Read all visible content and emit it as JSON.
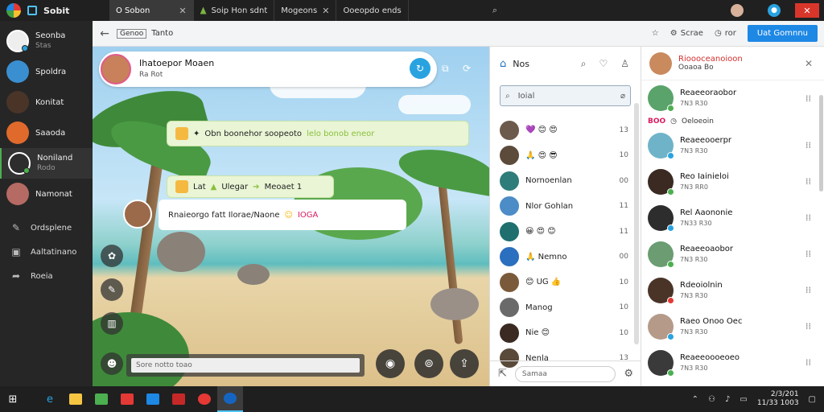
{
  "titlebar": {
    "app_name": "Sobit",
    "tabs": [
      {
        "label": "O Sobon",
        "active": true
      },
      {
        "label": "Soip Hon sdnt",
        "active": false
      },
      {
        "label": "Mogeons",
        "active": false
      },
      {
        "label": "Ooeopdo ends",
        "active": false
      }
    ]
  },
  "sidebar": {
    "contacts": [
      {
        "name": "Seonba",
        "sub": "Stas",
        "color": "#3b3b3b",
        "dot": true
      },
      {
        "name": "Spoldra",
        "sub": "",
        "color": "#3a8fd1",
        "dot": false
      },
      {
        "name": "Konitat",
        "sub": "",
        "color": "#4a3428",
        "dot": false
      },
      {
        "name": "Saaoda",
        "sub": "",
        "color": "#e06a2b",
        "dot": false
      },
      {
        "name": "Noniland",
        "sub": "Rodo",
        "color": "#2d2d2d",
        "dot": true,
        "active": true
      },
      {
        "name": "Namonat",
        "sub": "",
        "color": "#b56a63",
        "dot": false
      }
    ],
    "tools": [
      {
        "label": "Ordsplene",
        "icon": "chat-icon"
      },
      {
        "label": "Aaltatinano",
        "icon": "image-icon"
      },
      {
        "label": "Roeia",
        "icon": "share-icon"
      }
    ]
  },
  "toolbar": {
    "field_box": "Genoo",
    "field_text": "Tanto",
    "star": "☆",
    "item1": "Scrae",
    "item2": "ror",
    "button": "Uat Gomnnu"
  },
  "scene": {
    "header_name": "Ihatoepor Moaen",
    "header_sub": "Ra Rot",
    "note1_text": "Obn boonehor soopeoto",
    "note1_hl": "lelo bonob eneor",
    "note2_a": "Lat",
    "note2_b": "Ulegar",
    "note2_c": "Meoaet 1",
    "bubble_text": "Rnaieorgo fatt Ilorae/Naone",
    "bubble_pink": "IOGA",
    "input_placeholder": "Sore notto toao"
  },
  "contact_list": {
    "title": "Nos",
    "search_placeholder": "Ioial",
    "rows": [
      {
        "name": "💜 😊 😍",
        "num": "13",
        "color": "#6c5a4c"
      },
      {
        "name": "🙏 😍 😎",
        "num": "10",
        "color": "#5c4a3a"
      },
      {
        "name": "Nornoenlan",
        "num": "00",
        "color": "#2e7d7a"
      },
      {
        "name": "Nlor Gohlan",
        "num": "11",
        "color": "#4c8cc7"
      },
      {
        "name": "😀 😍 😊",
        "num": "11",
        "color": "#1f6f6f"
      },
      {
        "name": "🙏 Nemno",
        "num": "00",
        "color": "#2b6fbf"
      },
      {
        "name": "😊 UG 👍",
        "num": "10",
        "color": "#7a5a3a"
      },
      {
        "name": "Manog",
        "num": "10",
        "color": "#6a6a6a"
      },
      {
        "name": "Nie 😊",
        "num": "10",
        "color": "#3a2a22"
      },
      {
        "name": "Nenla",
        "num": "13",
        "color": "#5a4a3a"
      }
    ],
    "footer_placeholder": "Samaa"
  },
  "right_panel": {
    "title": "Rioooceanoioon",
    "subtitle": "Ooaoa Bo",
    "extra_red": "BOO",
    "extra_text": "Oeloeoin",
    "rows": [
      {
        "name": "Reaeeoraobor",
        "sub": "7N3 R30",
        "color": "#5aa36b",
        "dot": "#4caf50"
      },
      {
        "name": "Reaeeooerpr",
        "sub": "7N3 R30",
        "color": "#6fb3c9",
        "dot": "#29a3e0"
      },
      {
        "name": "Reo Iainieloi",
        "sub": "7N3 RR0",
        "color": "#3a2a22",
        "dot": "#4caf50"
      },
      {
        "name": "Rel Aaononie",
        "sub": "7N33 R30",
        "color": "#2d2d2d",
        "dot": "#29a3e0"
      },
      {
        "name": "Reaeeoaobor",
        "sub": "7N3 R30",
        "color": "#6b9c72",
        "dot": "#4caf50"
      },
      {
        "name": "Rdeoiolnin",
        "sub": "7N3 R30",
        "color": "#4a3428",
        "dot": "#e53935"
      },
      {
        "name": "Raeo Onoo Oec",
        "sub": "7N3 R30",
        "color": "#b59a8a",
        "dot": "#29a3e0"
      },
      {
        "name": "Reaeeoooeoeo",
        "sub": "7N3 R30",
        "color": "#3a3a3a",
        "dot": "#4caf50"
      }
    ]
  },
  "taskbar": {
    "time": "2/3/201",
    "date": "11/33 1003"
  },
  "colors": {
    "accent": "#1e88e5",
    "online": "#4caf50",
    "close": "#d9362b"
  }
}
